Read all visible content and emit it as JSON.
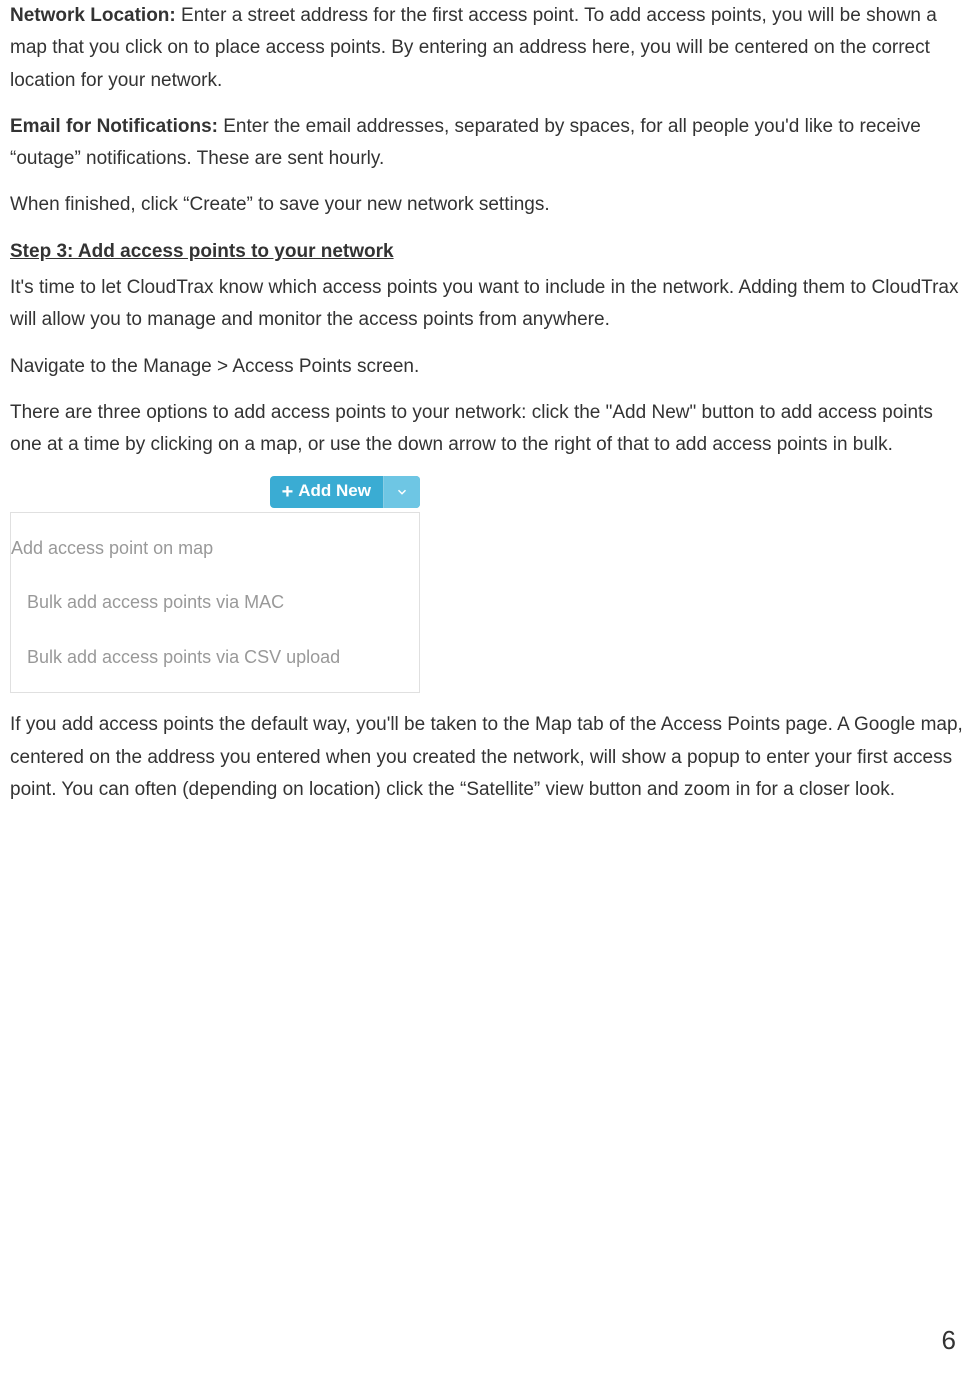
{
  "para1": {
    "label": "Network Location: ",
    "text": "Enter a street address for the first access point. To add access points, you will be shown a map that you click on to place access points. By entering an address here, you will be centered on the correct location for your network."
  },
  "para2": {
    "label": "Email for Notifications: ",
    "text": "Enter the email addresses, separated by spaces, for all people you'd like to receive “outage” notifications. These are sent hourly."
  },
  "para3": "When finished, click “Create” to save your new network settings.",
  "step3_heading": "Step 3: Add access points to your network",
  "para4": "It's time to let CloudTrax know which access points you want to include in the network. Adding them to CloudTrax will allow you to manage and monitor the access points from anywhere.",
  "para5": "Navigate to the Manage > Access Points screen.",
  "para6": "There are three options to add access points to your network: click the \"Add New\" button to add access points one at a time by clicking on a map, or use the down arrow to the right of that to add access points in bulk.",
  "add_new_button": "Add New",
  "dropdown_items": [
    "Add access point on map",
    "Bulk add access points via MAC",
    "Bulk add access points via CSV upload"
  ],
  "para7": "If you add access points the default way, you'll be taken to the Map tab of the Access Points page. A Google map, centered on the address you entered when you created the network, will show a popup to enter your first access point. You can often (depending on location) click the “Satellite” view button and zoom in for a closer look.",
  "page_number": "6"
}
